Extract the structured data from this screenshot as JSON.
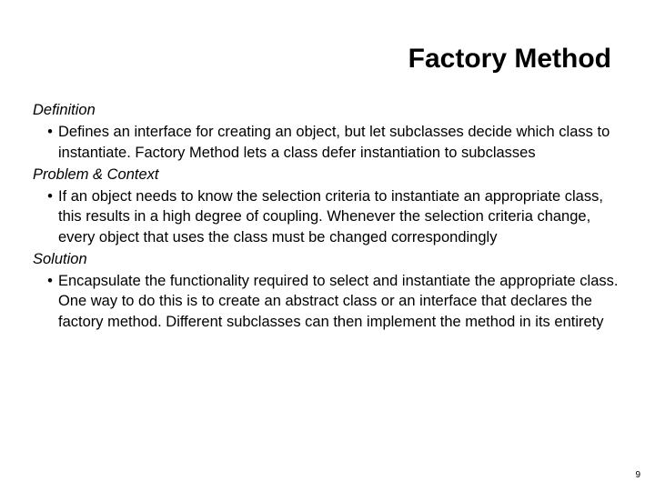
{
  "title": "Factory Method",
  "sections": [
    {
      "heading": "Definition",
      "bullet": "Defines an interface for creating an object, but let subclasses decide which class to instantiate. Factory Method lets a class defer instantiation to subclasses"
    },
    {
      "heading": "Problem & Context",
      "bullet": "If an object needs to know the selection criteria to instantiate an appropriate class, this results in a high degree of coupling. Whenever the selection criteria change, every object that uses the class must be changed correspondingly"
    },
    {
      "heading": "Solution",
      "bullet": "Encapsulate the functionality required to select and instantiate the appropriate class. One way to do this is to create an abstract class or an interface that declares the factory method. Different subclasses can then implement the method in its entirety"
    }
  ],
  "bullet_char": "•",
  "page_number": "9"
}
